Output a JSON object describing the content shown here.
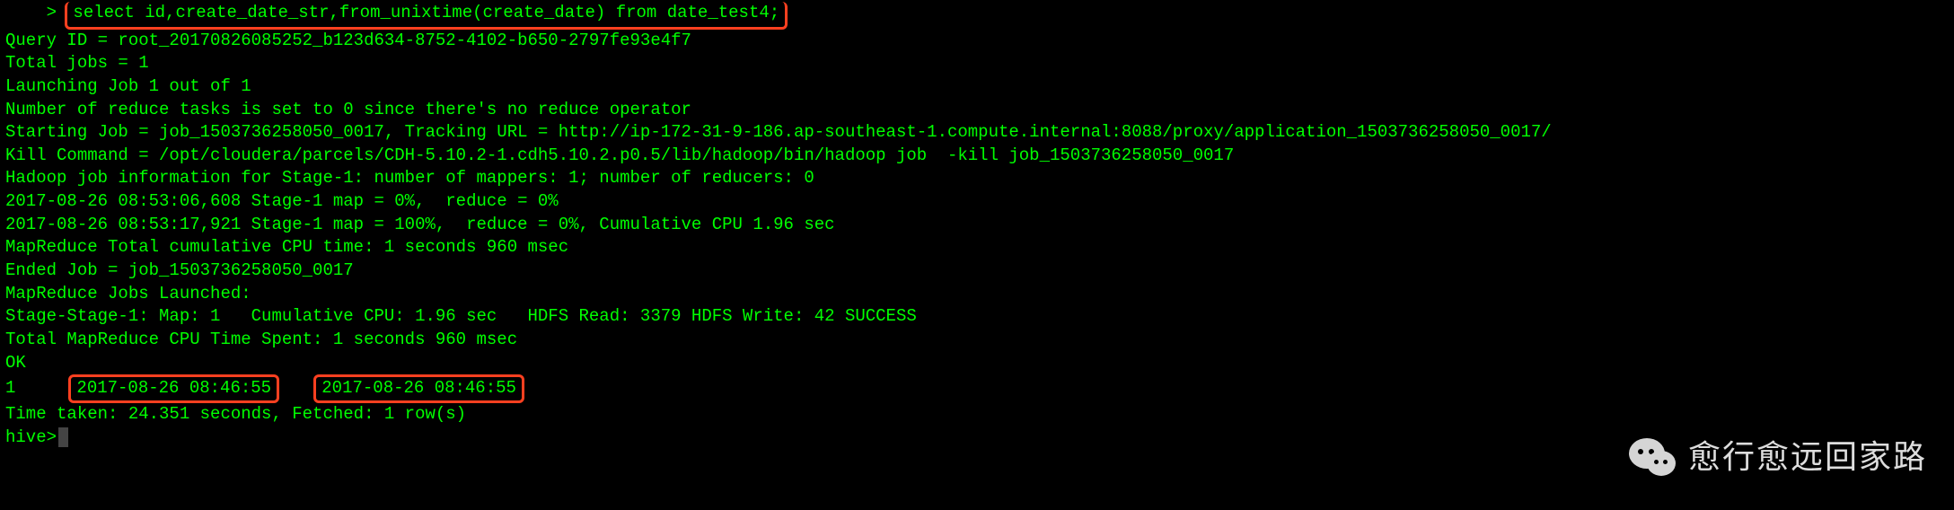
{
  "terminal": {
    "lines": {
      "l0_prompt_caret": "    > ",
      "l0_sql": "select id,create_date_str,from_unixtime(create_date) from date_test4;",
      "l1": "Query ID = root_20170826085252_b123d634-8752-4102-b650-2797fe93e4f7",
      "l2": "Total jobs = 1",
      "l3": "Launching Job 1 out of 1",
      "l4": "Number of reduce tasks is set to 0 since there's no reduce operator",
      "l5": "Starting Job = job_1503736258050_0017, Tracking URL = http://ip-172-31-9-186.ap-southeast-1.compute.internal:8088/proxy/application_1503736258050_0017/",
      "l6": "Kill Command = /opt/cloudera/parcels/CDH-5.10.2-1.cdh5.10.2.p0.5/lib/hadoop/bin/hadoop job  -kill job_1503736258050_0017",
      "l7": "Hadoop job information for Stage-1: number of mappers: 1; number of reducers: 0",
      "l8": "2017-08-26 08:53:06,608 Stage-1 map = 0%,  reduce = 0%",
      "l9": "2017-08-26 08:53:17,921 Stage-1 map = 100%,  reduce = 0%, Cumulative CPU 1.96 sec",
      "l10": "MapReduce Total cumulative CPU time: 1 seconds 960 msec",
      "l11": "Ended Job = job_1503736258050_0017",
      "l12": "MapReduce Jobs Launched:",
      "l13": "Stage-Stage-1: Map: 1   Cumulative CPU: 1.96 sec   HDFS Read: 3379 HDFS Write: 42 SUCCESS",
      "l14": "Total MapReduce CPU Time Spent: 1 seconds 960 msec",
      "l15": "OK",
      "l16_id": "1",
      "l16_col2": "2017-08-26 08:46:55",
      "l16_col3": "2017-08-26 08:46:55",
      "l17": "Time taken: 24.351 seconds, Fetched: 1 row(s)",
      "l18_prompt": "hive>"
    }
  },
  "watermark": {
    "text": "愈行愈远回家路"
  }
}
